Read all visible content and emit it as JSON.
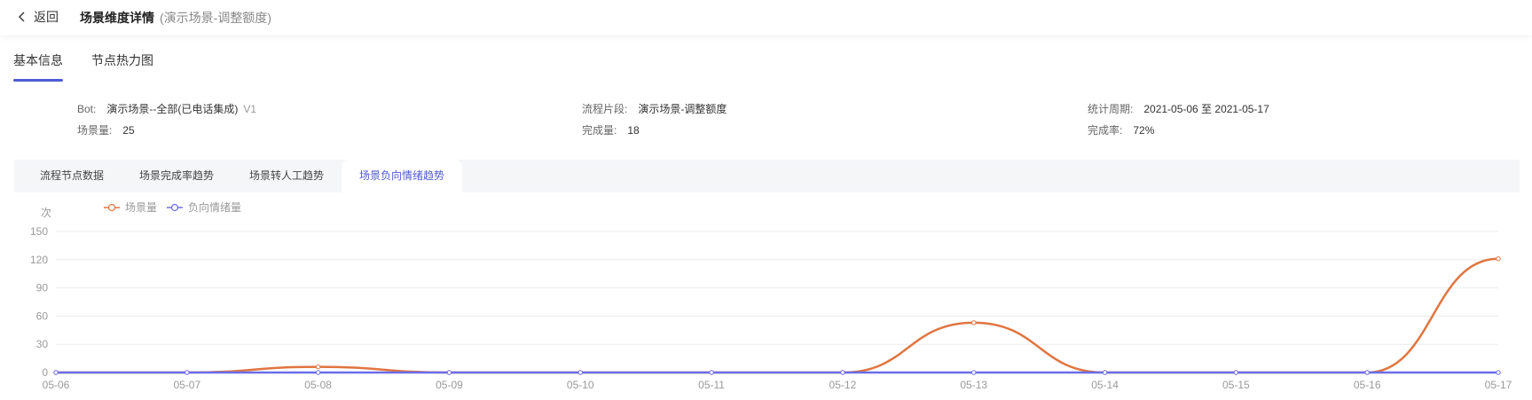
{
  "header": {
    "back_label": "返回",
    "title": "场景维度详情",
    "subtitle": "(演示场景-调整额度)"
  },
  "tabs": [
    {
      "label": "基本信息",
      "active": true
    },
    {
      "label": "节点热力图",
      "active": false
    }
  ],
  "info": {
    "bot_label": "Bot:",
    "bot_value": "演示场景--全部(已电话集成)",
    "bot_version": "V1",
    "scene_count_label": "场景量:",
    "scene_count_value": "25",
    "segment_label": "流程片段:",
    "segment_value": "演示场景-调整额度",
    "complete_label": "完成量:",
    "complete_value": "18",
    "period_label": "统计周期:",
    "period_value": "2021-05-06 至 2021-05-17",
    "rate_label": "完成率:",
    "rate_value": "72%"
  },
  "subtabs": [
    {
      "label": "流程节点数据",
      "active": false
    },
    {
      "label": "场景完成率趋势",
      "active": false
    },
    {
      "label": "场景转人工趋势",
      "active": false
    },
    {
      "label": "场景负向情绪趋势",
      "active": true
    }
  ],
  "colors": {
    "accent": "#4f5bd5",
    "series_scene": "#e07540",
    "series_negative": "#6b6ee8"
  },
  "chart_data": {
    "type": "line",
    "title": "",
    "ylabel": "次",
    "ylim": [
      0,
      150
    ],
    "yticks": [
      0,
      30,
      60,
      90,
      120,
      150
    ],
    "grid": true,
    "legend": "top-left",
    "x": [
      "05-06",
      "05-07",
      "05-08",
      "05-09",
      "05-10",
      "05-11",
      "05-12",
      "05-13",
      "05-14",
      "05-15",
      "05-16",
      "05-17"
    ],
    "series": [
      {
        "name": "场景量",
        "color": "#e07540",
        "values": [
          0,
          0,
          6,
          0,
          0,
          0,
          0,
          53,
          0,
          0,
          0,
          121
        ]
      },
      {
        "name": "负向情绪量",
        "color": "#6b6ee8",
        "values": [
          0,
          0,
          0,
          0,
          0,
          0,
          0,
          0,
          0,
          0,
          0,
          0
        ]
      }
    ]
  }
}
